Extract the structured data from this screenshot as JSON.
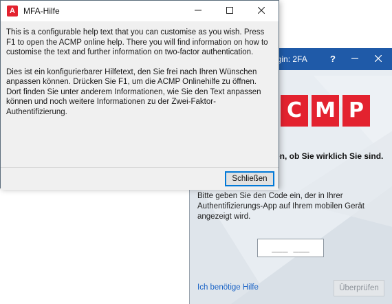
{
  "login_window": {
    "title": "ogin: 2FA",
    "help_label": "?",
    "logo_letters": [
      "C",
      "M",
      "P"
    ],
    "heading": "en, ob Sie wirklich Sie sind.",
    "instructions": "Bitte geben Sie den Code ein, der in Ihrer Authentifizierungs-App auf Ihrem mobilen Gerät angezeigt wird.",
    "code_placeholder": "___ ___",
    "help_link": "Ich benötige Hilfe",
    "verify_button": "Überprüfen",
    "colors": {
      "titlebar": "#1f5aa8",
      "brand_red": "#e3222f",
      "link": "#1a63c6"
    }
  },
  "help_dialog": {
    "app_icon_letter": "A",
    "title": "MFA-Hilfe",
    "paragraphs": [
      "This is a configurable help text that you can customise as you wish. Press F1 to open the ACMP online help. There you will find information on how to customise the text and further information on two-factor authentication.",
      "Dies ist ein konfigurierbarer Hilfetext, den Sie frei nach Ihren Wünschen anpassen können. Drücken Sie F1, um die ACMP Onlinehilfe zu öffnen. Dort finden Sie unter anderem Informationen, wie Sie den Text anpassen können und noch weitere Informationen zu der Zwei-Faktor-Authentifizierung."
    ],
    "close_button": "Schließen",
    "icons": {
      "minimize": "minimize-icon",
      "maximize": "maximize-icon",
      "close": "close-icon"
    }
  }
}
